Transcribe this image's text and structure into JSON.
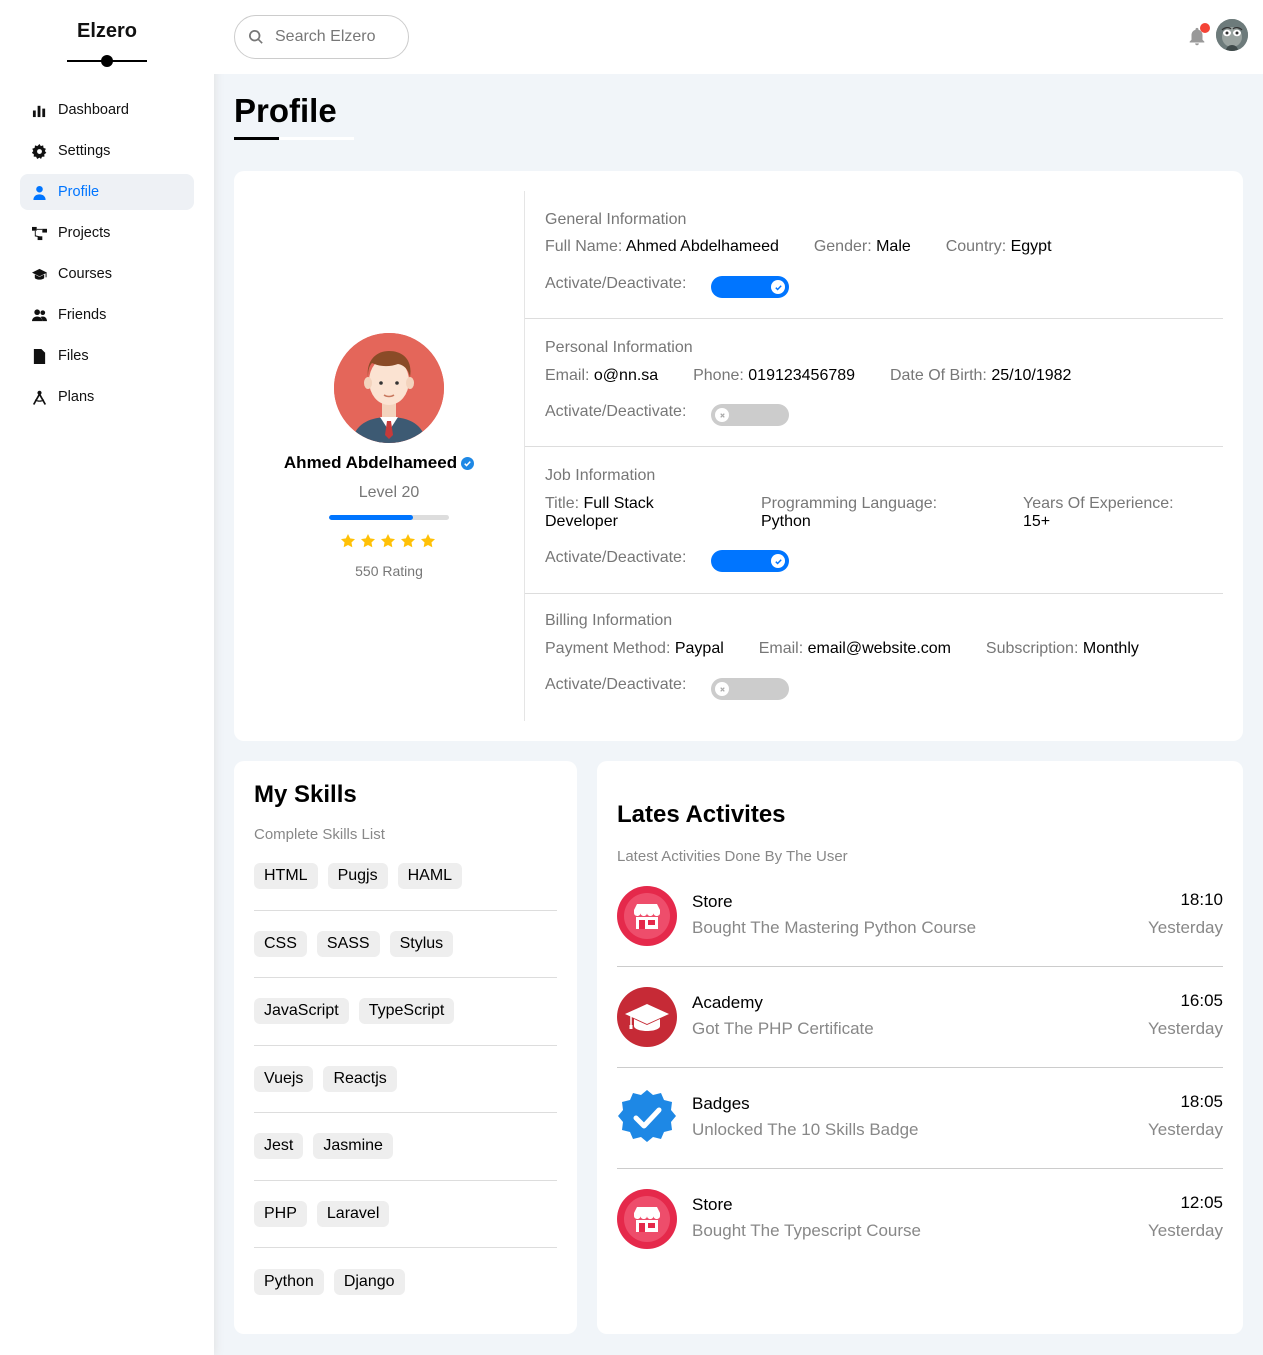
{
  "brand": "Elzero",
  "sidebar": {
    "items": [
      {
        "label": "Dashboard",
        "icon": "chart-bar-icon",
        "active": false
      },
      {
        "label": "Settings",
        "icon": "gear-icon",
        "active": false
      },
      {
        "label": "Profile",
        "icon": "user-icon",
        "active": true
      },
      {
        "label": "Projects",
        "icon": "diagram-project-icon",
        "active": false
      },
      {
        "label": "Courses",
        "icon": "graduation-cap-icon",
        "active": false
      },
      {
        "label": "Friends",
        "icon": "users-icon",
        "active": false
      },
      {
        "label": "Files",
        "icon": "file-icon",
        "active": false
      },
      {
        "label": "Plans",
        "icon": "compass-drafting-icon",
        "active": false
      }
    ]
  },
  "header": {
    "search_placeholder": "Search Elzero",
    "notification_dot_color": "#f44336"
  },
  "page": {
    "title": "Profile"
  },
  "profile": {
    "name": "Ahmed Abdelhameed",
    "level": "Level 20",
    "level_progress": 0.7,
    "stars": 5,
    "rating": "550 Rating",
    "sections": {
      "general": {
        "title": "General Information",
        "full_name_label": "Full Name:",
        "full_name": "Ahmed Abdelhameed",
        "gender_label": "Gender:",
        "gender": "Male",
        "country_label": "Country:",
        "country": "Egypt",
        "toggle_label": "Activate/Deactivate:",
        "toggle_on": true
      },
      "personal": {
        "title": "Personal Information",
        "email_label": "Email:",
        "email": "o@nn.sa",
        "phone_label": "Phone:",
        "phone": "019123456789",
        "dob_label": "Date Of Birth:",
        "dob": "25/10/1982",
        "toggle_label": "Activate/Deactivate:",
        "toggle_on": false
      },
      "job": {
        "title": "Job Information",
        "title_label": "Title:",
        "job_title": "Full Stack Developer",
        "lang_label": "Programming Language:",
        "lang": "Python",
        "years_label": "Years Of Experience:",
        "years": "15+",
        "toggle_label": "Activate/Deactivate:",
        "toggle_on": true
      },
      "billing": {
        "title": "Billing Information",
        "payment_label": "Payment Method:",
        "payment": "Paypal",
        "email_label": "Email:",
        "email": "email@website.com",
        "subscription_label": "Subscription:",
        "subscription": "Monthly",
        "toggle_label": "Activate/Deactivate:",
        "toggle_on": false
      }
    }
  },
  "skills": {
    "title": "My Skills",
    "subtitle": "Complete Skills List",
    "rows": [
      [
        "HTML",
        "Pugjs",
        "HAML"
      ],
      [
        "CSS",
        "SASS",
        "Stylus"
      ],
      [
        "JavaScript",
        "TypeScript"
      ],
      [
        "Vuejs",
        "Reactjs"
      ],
      [
        "Jest",
        "Jasmine"
      ],
      [
        "PHP",
        "Laravel"
      ],
      [
        "Python",
        "Django"
      ]
    ]
  },
  "activities": {
    "title": "Lates Activites",
    "subtitle": "Latest Activities Done By The User",
    "items": [
      {
        "icon": "store-icon",
        "title": "Store",
        "desc": "Bought The Mastering Python Course",
        "time": "18:10",
        "day": "Yesterday"
      },
      {
        "icon": "academy-icon",
        "title": "Academy",
        "desc": "Got The PHP Certificate",
        "time": "16:05",
        "day": "Yesterday"
      },
      {
        "icon": "badge-icon",
        "title": "Badges",
        "desc": "Unlocked The 10 Skills Badge",
        "time": "18:05",
        "day": "Yesterday"
      },
      {
        "icon": "store-icon",
        "title": "Store",
        "desc": "Bought The Typescript Course",
        "time": "12:05",
        "day": "Yesterday"
      }
    ]
  },
  "colors": {
    "accent": "#0075ff",
    "background": "#f1f5f9",
    "star": "#ffc107",
    "store": "#e5294b",
    "academy": "#c62a36",
    "badge": "#1e88e5"
  }
}
